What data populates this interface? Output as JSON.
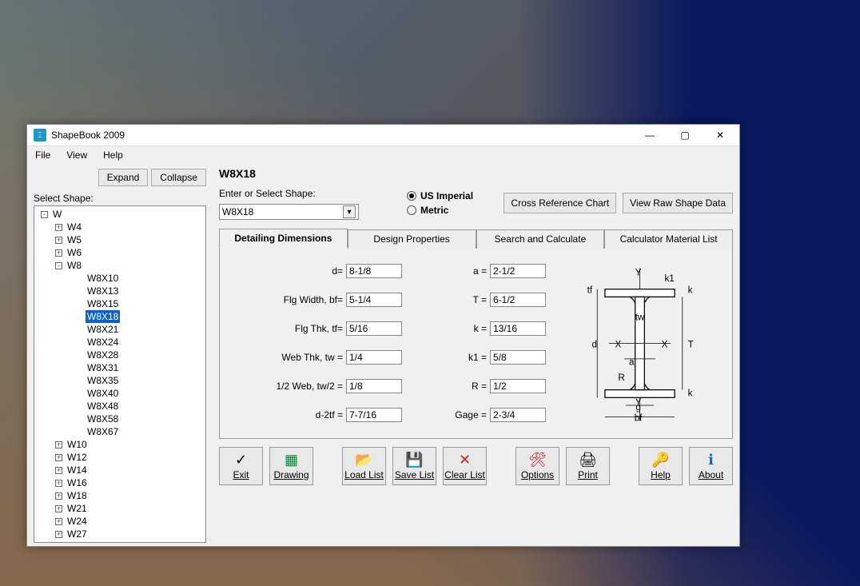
{
  "window": {
    "title": "ShapeBook 2009"
  },
  "menu": {
    "file": "File",
    "view": "View",
    "help": "Help"
  },
  "sidebar": {
    "label": "Select Shape:",
    "expand": "Expand",
    "collapse": "Collapse",
    "root": "W",
    "nodes": [
      {
        "label": "W4",
        "exp": "+"
      },
      {
        "label": "W5",
        "exp": "+"
      },
      {
        "label": "W6",
        "exp": "+"
      },
      {
        "label": "W8",
        "exp": "-",
        "children": [
          "W8X10",
          "W8X13",
          "W8X15",
          "W8X18",
          "W8X21",
          "W8X24",
          "W8X28",
          "W8X31",
          "W8X35",
          "W8X40",
          "W8X48",
          "W8X58",
          "W8X67"
        ],
        "selectedIndex": 3
      },
      {
        "label": "W10",
        "exp": "+"
      },
      {
        "label": "W12",
        "exp": "+"
      },
      {
        "label": "W14",
        "exp": "+"
      },
      {
        "label": "W16",
        "exp": "+"
      },
      {
        "label": "W18",
        "exp": "+"
      },
      {
        "label": "W21",
        "exp": "+"
      },
      {
        "label": "W24",
        "exp": "+"
      },
      {
        "label": "W27",
        "exp": "+"
      }
    ]
  },
  "header": {
    "shape": "W8X18",
    "enter_label": "Enter or Select Shape:",
    "selected_shape": "W8X18",
    "units": {
      "us": "US Imperial",
      "metric": "Metric"
    },
    "crossref": "Cross Reference Chart",
    "viewraw": "View Raw Shape Data"
  },
  "tabs": {
    "detailing": "Detailing Dimensions",
    "design": "Design Properties",
    "search": "Search and Calculate",
    "calc": "Calculator Material List"
  },
  "dims": {
    "d": {
      "label": "d=",
      "val": "8-1/8"
    },
    "bf": {
      "label": "Flg Width, bf=",
      "val": "5-1/4"
    },
    "tf": {
      "label": "Flg Thk, tf=",
      "val": "5/16"
    },
    "tw": {
      "label": "Web Thk, tw =",
      "val": "1/4"
    },
    "tw2": {
      "label": "1/2 Web, tw/2 =",
      "val": "1/8"
    },
    "d2tf": {
      "label": "d-2tf =",
      "val": "7-7/16"
    },
    "a": {
      "label": "a =",
      "val": "2-1/2"
    },
    "T": {
      "label": "T =",
      "val": "6-1/2"
    },
    "k": {
      "label": "k =",
      "val": "13/16"
    },
    "k1": {
      "label": "k1 =",
      "val": "5/8"
    },
    "R": {
      "label": "R =",
      "val": "1/2"
    },
    "gage": {
      "label": "Gage =",
      "val": "2-3/4"
    }
  },
  "bottom": {
    "exit": "Exit",
    "drawing": "Drawing",
    "load": "Load List",
    "save": "Save List",
    "clear": "Clear List",
    "options": "Options",
    "print": "Print",
    "help": "Help",
    "about": "About"
  }
}
